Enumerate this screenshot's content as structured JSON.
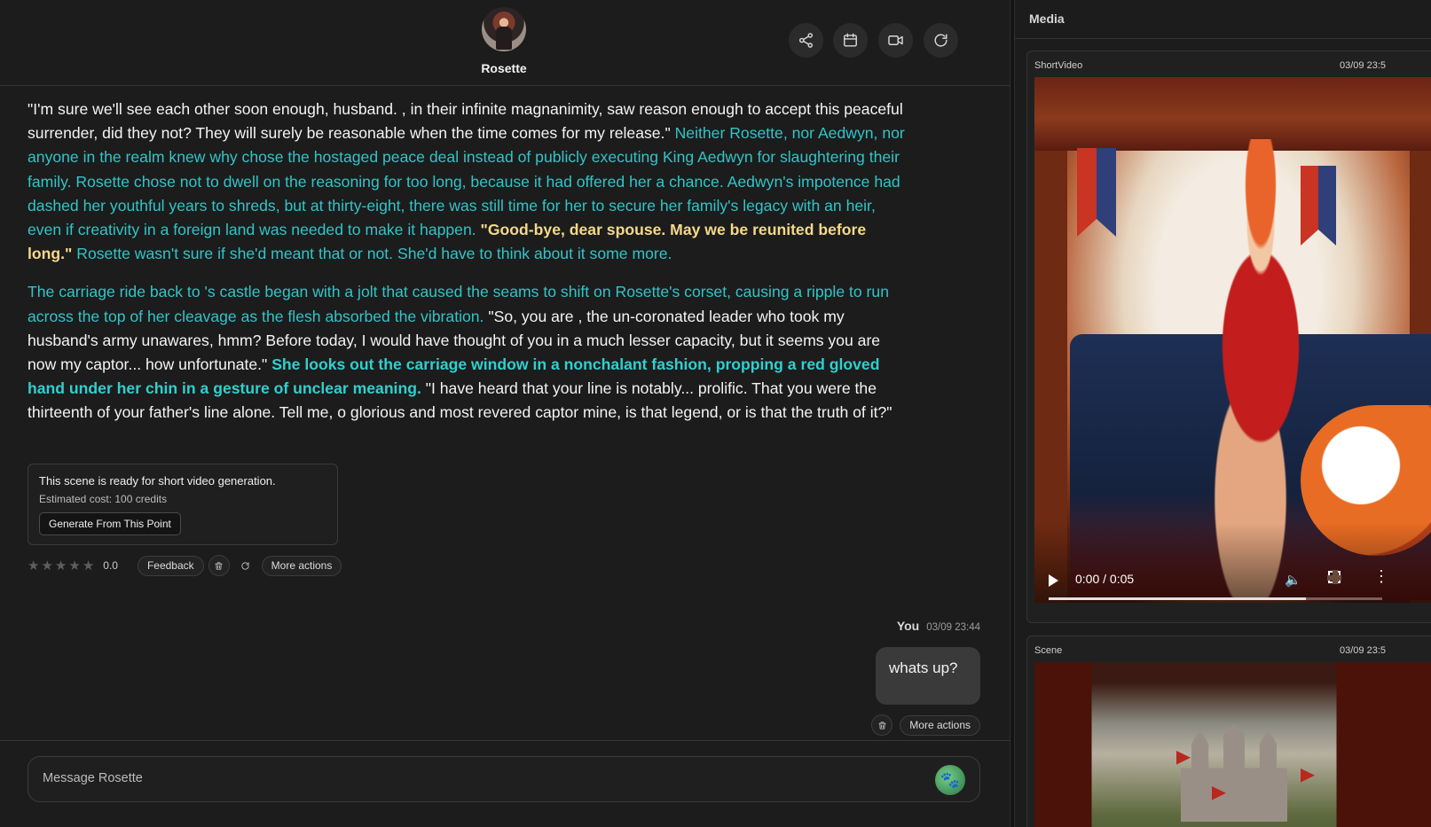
{
  "character": {
    "name": "Rosette"
  },
  "header_actions": [
    {
      "name": "share-icon"
    },
    {
      "name": "calendar-icon"
    },
    {
      "name": "video-camera-icon"
    },
    {
      "name": "refresh-icon"
    }
  ],
  "message": {
    "p1": {
      "s1": "\"I'm sure we'll see each other soon enough, husband. , in their infinite magnanimity, saw reason enough to accept this peaceful surrender, did they not? They will surely be reasonable when the time comes for my release.\" ",
      "s2": "Neither Rosette, nor Aedwyn, nor anyone in the realm knew why chose the hostaged peace deal instead of publicly executing King Aedwyn for slaughtering their family. Rosette chose not to dwell on the reasoning for too long, because it had offered her a chance. Aedwyn's impotence had dashed her youthful years to shreds, but at thirty-eight, there was still time for her to secure her family's legacy with an heir, even if creativity in a foreign land was needed to make it happen. ",
      "s3": "\"Good-bye, dear spouse. May we be reunited before long.\"",
      "s4": " Rosette wasn't sure if she'd meant that or not. She'd have to think about it some more."
    },
    "p2": {
      "s1": "The carriage ride back to 's castle began with a jolt that caused the seams to shift on Rosette's corset, causing a ripple to run across the top of her cleavage as the flesh absorbed the vibration.",
      "s2": " \"So, you are , the un-coronated leader who took my husband's army unawares, hmm? Before today, I would have thought of you in a much lesser capacity, but it seems you are now my captor... how unfortunate.\" ",
      "s3": "She looks out the carriage window in a nonchalant fashion, propping a red gloved hand under her chin in a gesture of unclear meaning.",
      "s4": " \"I have heard that your line is notably... prolific. That you were the thirteenth of your father's line alone. Tell me, o glorious and most revered captor mine, is that legend, or is that the truth of it?\""
    }
  },
  "generation_card": {
    "title": "This scene is ready for short video generation.",
    "cost": "Estimated cost: 100 credits",
    "button": "Generate From This Point"
  },
  "message_actions": {
    "stars": [
      "★",
      "★",
      "★",
      "★",
      "★"
    ],
    "rating": "0.0",
    "feedback": "Feedback",
    "more": "More actions"
  },
  "user_message": {
    "sender": "You",
    "time": "03/09 23:44",
    "text": "whats up?",
    "more": "More actions"
  },
  "composer": {
    "placeholder": "Message Rosette",
    "send_glyph": "🐾"
  },
  "media": {
    "title": "Media",
    "cards": [
      {
        "type": "ShortVideo",
        "time": "03/09 23:5",
        "video_time": "0:00 / 0:05",
        "progress_fraction": 0.77
      },
      {
        "type": "Scene",
        "time": "03/09 23:5"
      }
    ]
  }
}
